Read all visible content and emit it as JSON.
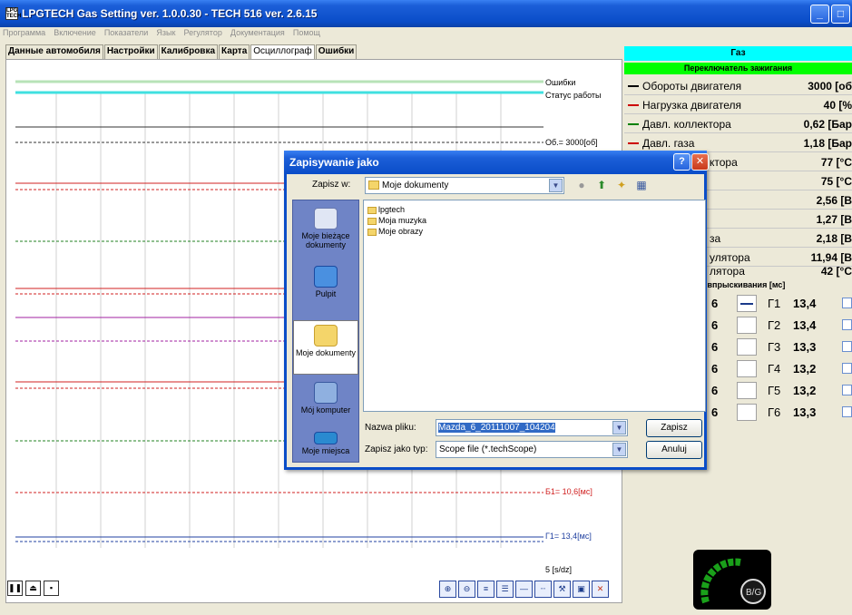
{
  "window": {
    "title": "LPGTECH Gas Setting  ver. 1.0.0.30  -  TECH 516  ver. 2.6.15",
    "app_icon_text": "LPG TECH"
  },
  "menu": [
    "Программа",
    "Включение",
    "Показатели",
    "Язык",
    "Регулятор",
    "Документация",
    "Помощ"
  ],
  "tabs": [
    "Данные автомобиля",
    "Настройки",
    "Калибровка",
    "Карта",
    "Осциллограф",
    "Ошибки"
  ],
  "active_tab": "Осциллограф",
  "scope": {
    "labels": {
      "errors": "Ошибки",
      "status": "Статус работы",
      "rpm": "Об.= 3000[об]",
      "b1": "Б1= 10,6[мс]",
      "g1": "Г1= 13,4[мс]",
      "timebase": "5 [s/dz]"
    }
  },
  "right_panel": {
    "gas_header": "Газ",
    "ignition_header": "Переключатель зажигания",
    "params": [
      {
        "label": "Обороты двигателя",
        "value": "3000 [об",
        "color": "#000000"
      },
      {
        "label": "Нагрузка двигателя",
        "value": "40 [%",
        "color": "#cc0000"
      },
      {
        "label": "Давл. коллектора",
        "value": "0,62 [Бар",
        "color": "#008000"
      },
      {
        "label": "Давл. газа",
        "value": "1,18 [Бар",
        "color": "#cc0000"
      },
      {
        "label": "ктора",
        "value": "77 [°C",
        "color": "#000000"
      },
      {
        "label": "",
        "value": "75 [°C",
        "color": "#000000"
      },
      {
        "label": "",
        "value": "2,56 [B",
        "color": "#000000"
      },
      {
        "label": "",
        "value": "1,27 [B",
        "color": "#000000"
      },
      {
        "label": "за",
        "value": "2,18 [B",
        "color": "#000000"
      },
      {
        "label": "улятора",
        "value": "11,94 [B",
        "color": "#000000"
      },
      {
        "label": "лятора",
        "value": "42 [°C",
        "color": "#000000"
      }
    ],
    "injection_header": "а впрыскивания [мс]",
    "injectors": [
      {
        "left": "6",
        "name": "Г1",
        "value": "13,4"
      },
      {
        "left": "6",
        "name": "Г2",
        "value": "13,4"
      },
      {
        "left": "6",
        "name": "Г3",
        "value": "13,3"
      },
      {
        "left": "6",
        "name": "Г4",
        "value": "13,2"
      },
      {
        "left": "6",
        "name": "Г5",
        "value": "13,2"
      },
      {
        "left": "6",
        "name": "Г6",
        "value": "13,3"
      }
    ],
    "gauge_label": "B/G"
  },
  "dialog": {
    "title": "Zapisywanie jako",
    "save_in_label": "Zapisz w:",
    "save_in_value": "Moje dokumenty",
    "places": [
      "Moje bieżące dokumenty",
      "Pulpit",
      "Moje dokumenty",
      "Mój komputer",
      "Moje miejsca"
    ],
    "files": [
      "lpgtech",
      "Moja muzyka",
      "Moje obrazy"
    ],
    "file_name_label": "Nazwa pliku:",
    "file_name_value": "Mazda_6_20111007_104204",
    "file_type_label": "Zapisz jako typ:",
    "file_type_value": "Scope file (*.techScope)",
    "save_button": "Zapisz",
    "cancel_button": "Anuluj"
  }
}
